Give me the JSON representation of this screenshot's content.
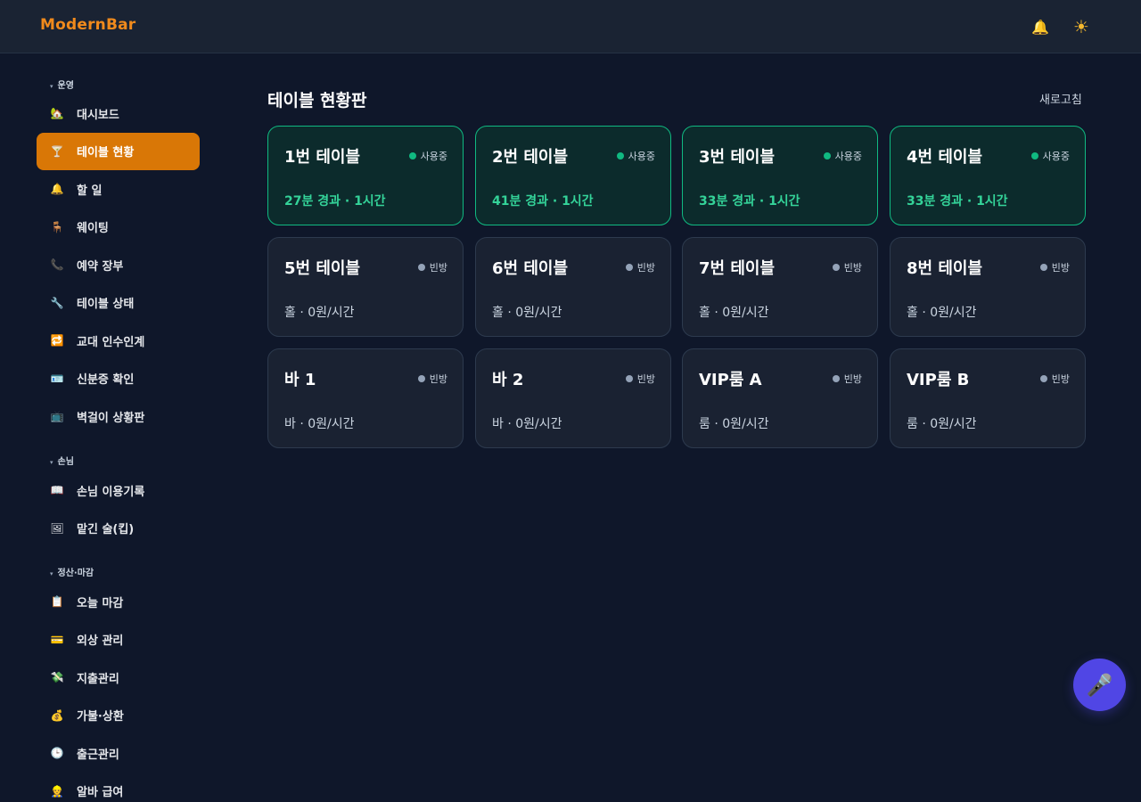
{
  "header": {
    "brand": "ModernBar",
    "bell_icon": "bell-icon",
    "theme_icon": "sun-icon"
  },
  "sidebar": {
    "groups": [
      {
        "title": "운영",
        "items": [
          {
            "label": "대시보드",
            "icon": "house-icon",
            "glyph": "🏡"
          },
          {
            "label": "테이블 현황",
            "icon": "cocktail-icon",
            "glyph": "🍸",
            "active": true
          },
          {
            "label": "할 일",
            "icon": "bell-icon",
            "glyph": "🔔"
          },
          {
            "label": "웨이팅",
            "icon": "chair-icon",
            "glyph": "🪑"
          },
          {
            "label": "예약 장부",
            "icon": "phone-icon",
            "glyph": "📞"
          },
          {
            "label": "테이블 상태",
            "icon": "wrench-icon",
            "glyph": "🔧"
          },
          {
            "label": "교대 인수인계",
            "icon": "repeat-icon",
            "glyph": "🔁"
          },
          {
            "label": "신분증 확인",
            "icon": "id-card-icon",
            "glyph": "🪪"
          },
          {
            "label": "벽걸이 상황판",
            "icon": "tv-icon",
            "glyph": "📺"
          }
        ]
      },
      {
        "title": "손님",
        "items": [
          {
            "label": "손님 이용기록",
            "icon": "book-icon",
            "glyph": "📖"
          },
          {
            "label": "맡긴 술(킵)",
            "icon": "picture-icon",
            "glyph": "🖼"
          }
        ]
      },
      {
        "title": "정산·마감",
        "items": [
          {
            "label": "오늘 마감",
            "icon": "clipboard-icon",
            "glyph": "📋"
          },
          {
            "label": "외상 관리",
            "icon": "credit-card-icon",
            "glyph": "💳"
          },
          {
            "label": "지출관리",
            "icon": "money-wings-icon",
            "glyph": "💸"
          },
          {
            "label": "가불·상환",
            "icon": "money-bag-icon",
            "glyph": "💰"
          },
          {
            "label": "출근관리",
            "icon": "clock-icon",
            "glyph": "🕒"
          },
          {
            "label": "알바 급여",
            "icon": "worker-icon",
            "glyph": "👷"
          }
        ]
      }
    ]
  },
  "main": {
    "title": "테이블 현황판",
    "refresh_label": "새로고침",
    "tables": [
      {
        "name": "1번 테이블",
        "status": "사용중",
        "busy": true,
        "sub": "27분 경과 · 1시간"
      },
      {
        "name": "2번 테이블",
        "status": "사용중",
        "busy": true,
        "sub": "41분 경과 · 1시간"
      },
      {
        "name": "3번 테이블",
        "status": "사용중",
        "busy": true,
        "sub": "33분 경과 · 1시간"
      },
      {
        "name": "4번 테이블",
        "status": "사용중",
        "busy": true,
        "sub": "33분 경과 · 1시간"
      },
      {
        "name": "5번 테이블",
        "status": "빈방",
        "busy": false,
        "sub": "홀 · 0원/시간"
      },
      {
        "name": "6번 테이블",
        "status": "빈방",
        "busy": false,
        "sub": "홀 · 0원/시간"
      },
      {
        "name": "7번 테이블",
        "status": "빈방",
        "busy": false,
        "sub": "홀 · 0원/시간"
      },
      {
        "name": "8번 테이블",
        "status": "빈방",
        "busy": false,
        "sub": "홀 · 0원/시간"
      },
      {
        "name": "바 1",
        "status": "빈방",
        "busy": false,
        "sub": "바 · 0원/시간"
      },
      {
        "name": "바 2",
        "status": "빈방",
        "busy": false,
        "sub": "바 · 0원/시간"
      },
      {
        "name": "VIP룸 A",
        "status": "빈방",
        "busy": false,
        "sub": "룸 · 0원/시간"
      },
      {
        "name": "VIP룸 B",
        "status": "빈방",
        "busy": false,
        "sub": "룸 · 0원/시간"
      }
    ]
  },
  "fab": {
    "icon": "microphone-icon"
  },
  "colors": {
    "accent": "#d97706",
    "brand": "#f08a1c",
    "busy": "#10b981",
    "idle": "#94a3b8",
    "fab": "#5046e5"
  }
}
